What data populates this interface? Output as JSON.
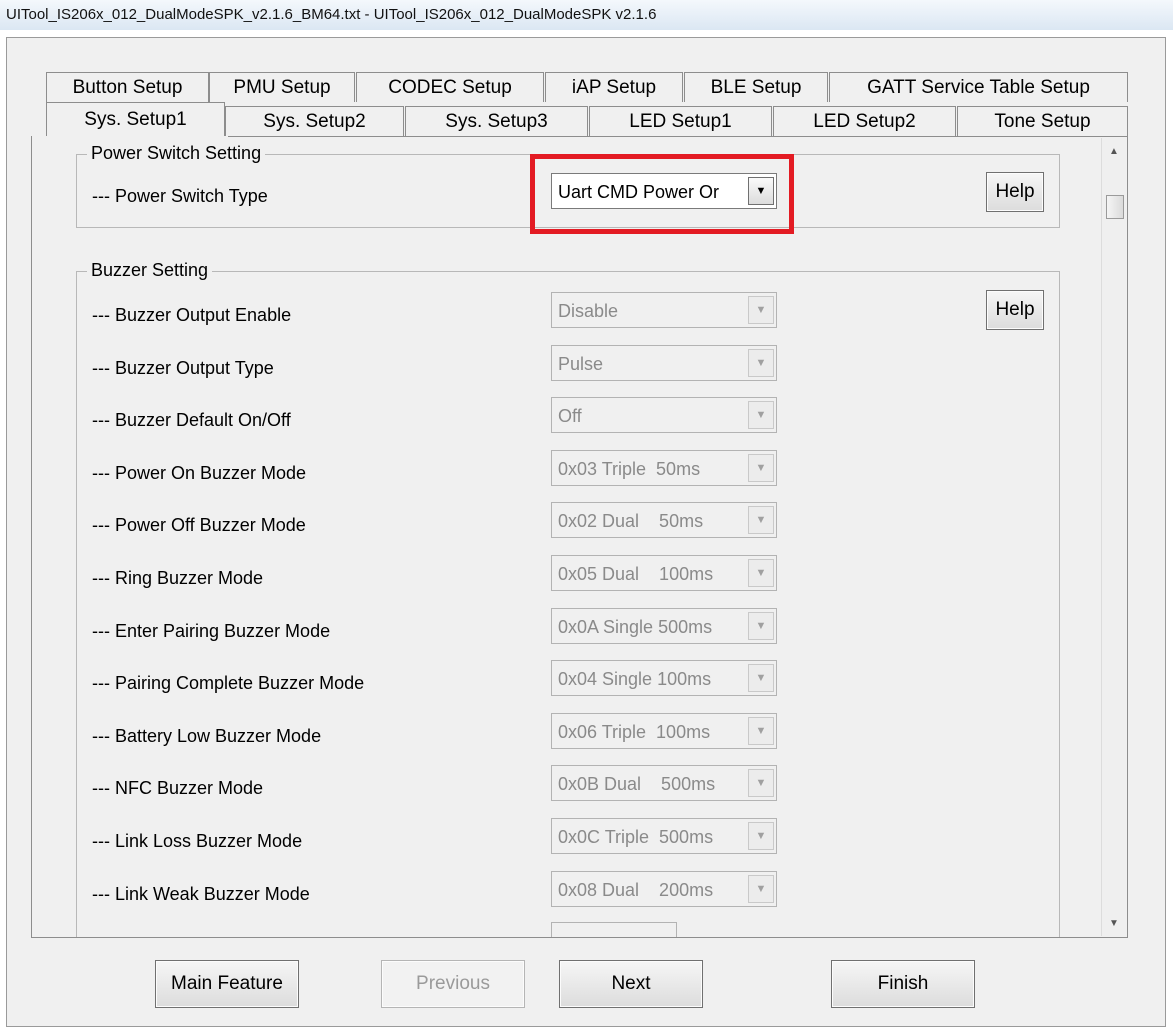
{
  "window": {
    "title": "UITool_IS206x_012_DualModeSPK_v2.1.6_BM64.txt - UITool_IS206x_012_DualModeSPK v2.1.6"
  },
  "tabs_row_back": [
    {
      "label": "Button Setup"
    },
    {
      "label": "PMU Setup"
    },
    {
      "label": "CODEC Setup"
    },
    {
      "label": "iAP Setup"
    },
    {
      "label": "BLE Setup"
    },
    {
      "label": "GATT Service Table Setup"
    }
  ],
  "tabs_row_front": [
    {
      "label": "Sys. Setup1",
      "active": true
    },
    {
      "label": "Sys. Setup2"
    },
    {
      "label": "Sys. Setup3"
    },
    {
      "label": "LED Setup1"
    },
    {
      "label": "LED Setup2"
    },
    {
      "label": "Tone Setup"
    }
  ],
  "power_switch": {
    "group_title": "Power Switch Setting",
    "label": "--- Power Switch Type",
    "value": "Uart CMD Power Or",
    "help_label": "Help",
    "highlight_color": "#e31b23"
  },
  "buzzer": {
    "group_title": "Buzzer Setting",
    "help_label": "Help",
    "rows": [
      {
        "label": "--- Buzzer Output Enable",
        "value": "Disable"
      },
      {
        "label": "--- Buzzer Output Type",
        "value": "Pulse"
      },
      {
        "label": "--- Buzzer Default On/Off",
        "value": "Off"
      },
      {
        "label": "--- Power On Buzzer Mode",
        "value": "0x03 Triple  50ms"
      },
      {
        "label": "--- Power Off Buzzer Mode",
        "value": "0x02 Dual    50ms"
      },
      {
        "label": "--- Ring Buzzer Mode",
        "value": "0x05 Dual    100ms"
      },
      {
        "label": "--- Enter Pairing Buzzer Mode",
        "value": "0x0A Single 500ms"
      },
      {
        "label": "--- Pairing Complete Buzzer Mode",
        "value": "0x04 Single 100ms"
      },
      {
        "label": "--- Battery Low Buzzer Mode",
        "value": "0x06 Triple  100ms"
      },
      {
        "label": "--- NFC Buzzer Mode",
        "value": "0x0B Dual    500ms"
      },
      {
        "label": "--- Link Loss Buzzer Mode",
        "value": "0x0C Triple  500ms"
      },
      {
        "label": "--- Link Weak Buzzer Mode",
        "value": "0x08 Dual    200ms"
      }
    ]
  },
  "footer": {
    "main_feature": "Main Feature",
    "previous": "Previous",
    "next": "Next",
    "finish": "Finish"
  }
}
